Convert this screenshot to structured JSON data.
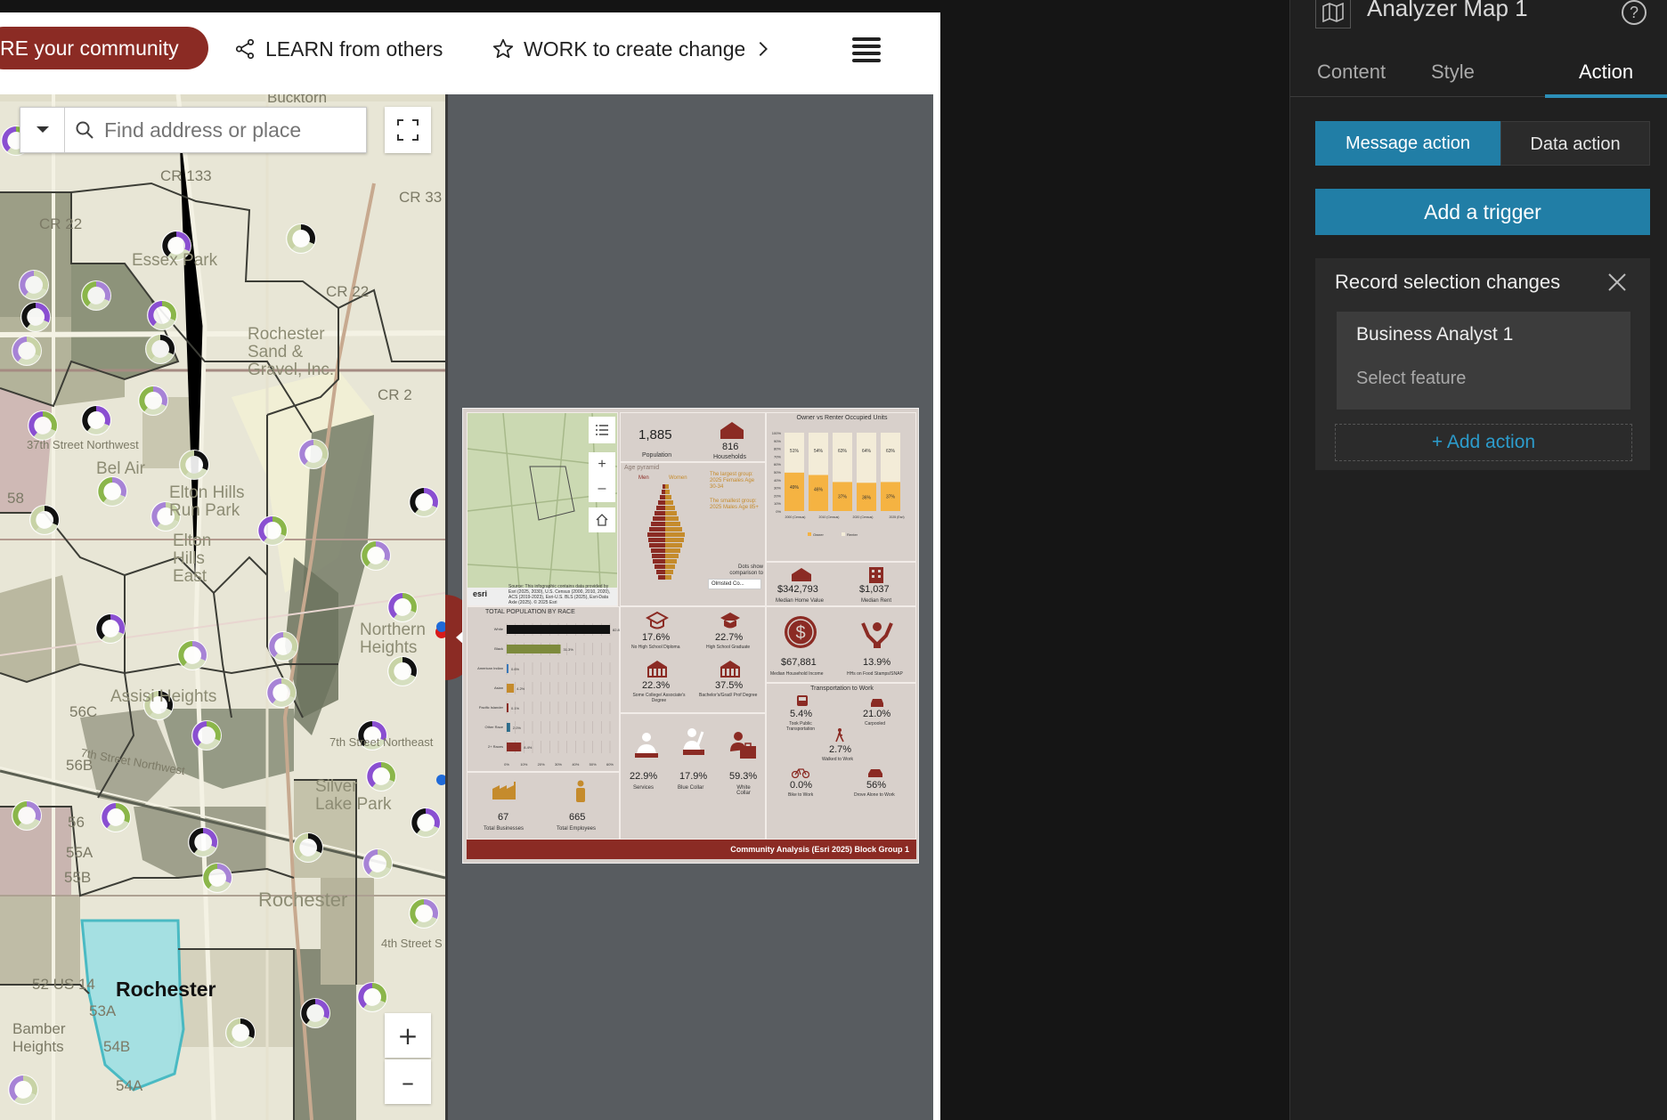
{
  "nav": {
    "explore_label": "RE your community",
    "learn_label": "LEARN from others",
    "work_label": "WORK to create change"
  },
  "map": {
    "search_placeholder": "Find address or place",
    "zoom_in": "+",
    "zoom_out": "–",
    "labels": {
      "bucktorn": "Bucktorn",
      "cr133": "CR 133",
      "cr33": "CR 33",
      "cr22a": "CR 22",
      "cr22b": "CR 22",
      "cr2x": "CR 2",
      "essex": "Essex Park",
      "rochester_sand": "Rochester Sand & Gravel, Inc.",
      "street37": "37th Street Northwest",
      "belair": "Bel Air",
      "elton": "Elton Hills Run Park",
      "eltonE": "Elton Hills East",
      "northern": "Northern Heights",
      "assisi": "Assisi Heights",
      "silver": "Silver Lake Park",
      "st7": "7th Street Northwest",
      "st7b": "7th Street Northeast",
      "st4": "4th Street S",
      "rochester": "Rochester",
      "rochester_faint": "Rochester",
      "bamber": "Bamber Heights",
      "r56c": "56C",
      "r56b": "56B",
      "r56": "56",
      "r55a": "55A",
      "r55b": "55B",
      "r54a": "54A",
      "r54b": "54B",
      "r53a": "53A",
      "us14": "52 US 14",
      "r58": "58"
    }
  },
  "infographic": {
    "population": "1,885",
    "population_label": "Population",
    "households": "816",
    "households_label": "Households",
    "age_pyramid_label": "Age pyramid",
    "men": "Men",
    "women": "Women",
    "largest_group": "The largest group: 2025 Females Age 30-34",
    "smallest_group": "The smallest group: 2025 Males Age 85+",
    "dots_show": "Dots show comparison to",
    "dropdown": "Olmsted Co...",
    "source_note": "Source: This infographic contains data provided by Esri (2025, 2030), U.S. Census (2000, 2010, 2020), ACS (2019-2023), Esri-U.S. BLS (2025), Esri-Data Axle (2025). © 2025 Esri",
    "owner_renter_title": "Owner vs Renter Occupied Units",
    "owner_label": "Owner",
    "renter_label": "Renter",
    "bar_top": [
      "51%",
      "54%",
      "63%",
      "64%",
      "63%"
    ],
    "bar_bottom": [
      "49%",
      "46%",
      "37%",
      "36%",
      "37%"
    ],
    "bar_years": [
      "2000 (Census)",
      "2010 (Census)",
      "2020 (Census)",
      "2025 (Esri)"
    ],
    "y_ticks": [
      "100%",
      "90%",
      "80%",
      "70%",
      "60%",
      "50%",
      "40%",
      "30%",
      "20%",
      "10%",
      "0%"
    ],
    "home_value": "$342,793",
    "home_value_label": "Median Home Value",
    "rent": "$1,037",
    "rent_label": "Median Rent",
    "race_title": "TOTAL POPULATION BY RACE",
    "race_rows": [
      {
        "name": "White",
        "pct": "82.8%"
      },
      {
        "name": "Black",
        "pct": "31.3%"
      },
      {
        "name": "American Indian",
        "pct": "0.6%"
      },
      {
        "name": "Asian",
        "pct": "4.2%"
      },
      {
        "name": "Pacific Islander",
        "pct": "0.1%"
      },
      {
        "name": "Other Race",
        "pct": "2.0%"
      },
      {
        "name": "2+ Races",
        "pct": "8.4%"
      }
    ],
    "race_axis": [
      "0%",
      "10%",
      "20%",
      "30%",
      "40%",
      "50%",
      "60%"
    ],
    "edu": [
      {
        "value": "17.6%",
        "label": "No High School Diploma"
      },
      {
        "value": "22.7%",
        "label": "High School Graduate"
      },
      {
        "value": "22.3%",
        "label": "Some College/ Associate's Degree"
      },
      {
        "value": "37.5%",
        "label": "Bachelor's/Grad/ Prof Degree"
      }
    ],
    "income": "$67,881",
    "income_label": "Median Household Income",
    "snap": "13.9%",
    "snap_label": "HHs on Food Stamps/SNAP",
    "transport_title": "Transportation to Work",
    "transport": [
      {
        "value": "5.4%",
        "label": "Took Public Transportation"
      },
      {
        "value": "21.0%",
        "label": "Carpooled"
      },
      {
        "value": "2.7%",
        "label": "Walked to Work"
      },
      {
        "value": "0.0%",
        "label": "Bike to Work"
      },
      {
        "value": "56%",
        "label": "Drove Alone to Work"
      }
    ],
    "jobs": [
      {
        "value": "22.9%",
        "label": "Services"
      },
      {
        "value": "17.9%",
        "label": "Blue Collar"
      },
      {
        "value": "59.3%",
        "label": "White Collar"
      }
    ],
    "businesses": "67",
    "businesses_label": "Total Businesses",
    "employees": "665",
    "employees_label": "Total Employees",
    "footer": "Community Analysis (Esri 2025) Block Group 1",
    "esri": "esri"
  },
  "panel": {
    "title": "Analyzer Map 1",
    "help": "?",
    "tabs": [
      "Content",
      "Style",
      "Action"
    ],
    "message_action": "Message action",
    "data_action": "Data action",
    "add_trigger": "Add a trigger",
    "trigger_title": "Record selection changes",
    "trigger_source": "Business Analyst 1",
    "trigger_select": "Select feature",
    "add_action": "+ Add action"
  },
  "colors": {
    "brand_red": "#8b2b24",
    "accent_blue": "#217ea6",
    "link_blue": "#2c9ccc",
    "owner_orange": "#f5b342",
    "renter_cream": "#f3ecd8"
  }
}
